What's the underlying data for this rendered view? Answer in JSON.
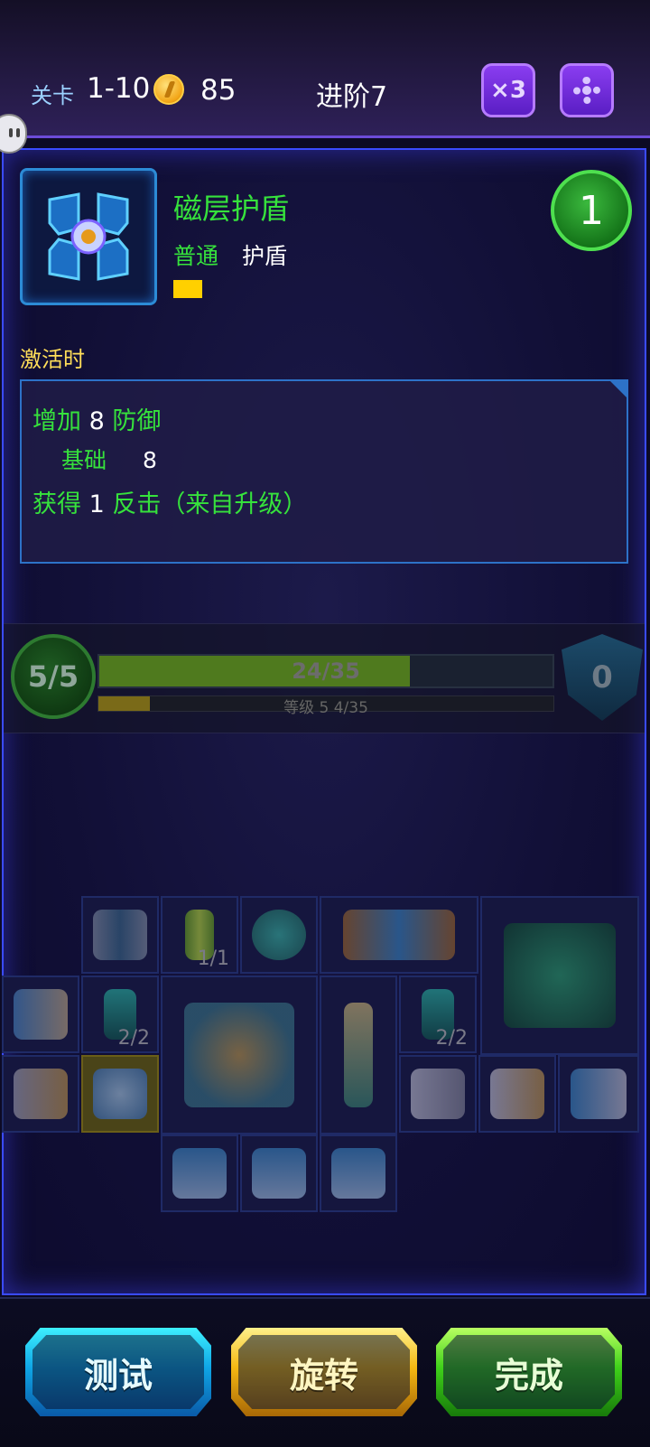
{
  "header": {
    "level_label": "关卡",
    "level_value": "1-10",
    "coin_icon": "gold-coin-icon",
    "coins": "85",
    "stage": "进阶7",
    "speed_label": "×3",
    "settings_icon": "gear-icon"
  },
  "item": {
    "name": "磁层护盾",
    "rarity": "普通",
    "type": "护盾",
    "count": "1",
    "name_color": "#36e23c",
    "tag_color": "#ffd000"
  },
  "effects": {
    "section_label": "激活时",
    "line1_prefix": "增加",
    "line1_value": "8",
    "line1_suffix": "防御",
    "line2_label": "基础",
    "line2_value": "8",
    "line3_prefix": "获得",
    "line3_value": "1",
    "line3_suffix": "反击（来自升级）"
  },
  "stats": {
    "hp_circle": "5/5",
    "hp_bar_text": "24/35",
    "hp_fraction": 0.686,
    "xp_bar_text": "等级 5  4/35",
    "xp_fraction": 0.114,
    "shield_value": "0"
  },
  "inventory": {
    "count_1_1": "1/1",
    "count_2_2_left": "2/2",
    "count_2_2_right": "2/2"
  },
  "footer": {
    "test_label": "测试",
    "rotate_label": "旋转",
    "done_label": "完成"
  }
}
